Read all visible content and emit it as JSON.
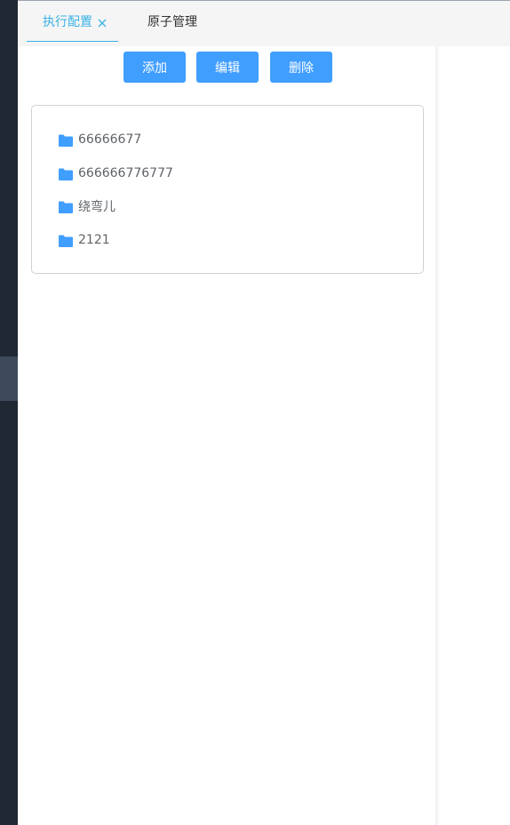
{
  "tabs": [
    {
      "label": "执行配置",
      "active": true,
      "closable": true
    },
    {
      "label": "原子管理",
      "active": false,
      "closable": false
    }
  ],
  "toolbar": {
    "add_label": "添加",
    "edit_label": "编辑",
    "delete_label": "删除"
  },
  "tree": {
    "items": [
      {
        "label": "66666677",
        "icon": "folder-icon"
      },
      {
        "label": "666666776777",
        "icon": "folder-icon"
      },
      {
        "label": "绕弯儿",
        "icon": "folder-icon"
      },
      {
        "label": "2121",
        "icon": "folder-icon"
      }
    ]
  },
  "colors": {
    "accent": "#3ab2e6",
    "button": "#409eff",
    "folder": "#409eff",
    "sidebar": "#1f2833",
    "sidebar_active": "#3d4a5b"
  }
}
